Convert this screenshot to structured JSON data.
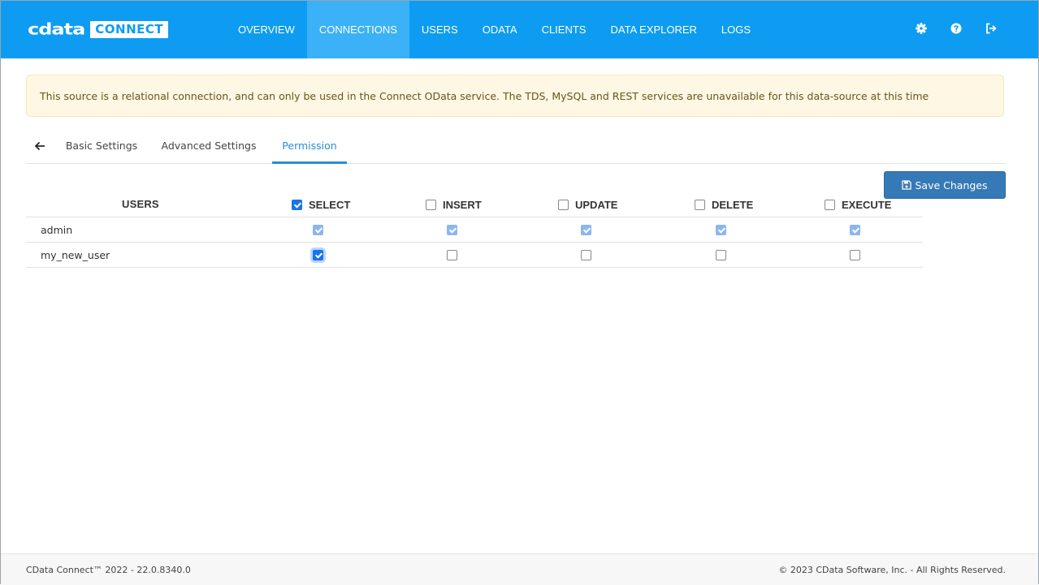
{
  "brand": {
    "word": "cdata",
    "badge": "CONNECT"
  },
  "nav": {
    "items": [
      {
        "label": "OVERVIEW",
        "active": false
      },
      {
        "label": "CONNECTIONS",
        "active": true
      },
      {
        "label": "USERS",
        "active": false
      },
      {
        "label": "ODATA",
        "active": false
      },
      {
        "label": "CLIENTS",
        "active": false
      },
      {
        "label": "DATA EXPLORER",
        "active": false
      },
      {
        "label": "LOGS",
        "active": false
      }
    ],
    "icons": [
      "gear-icon",
      "help-icon",
      "logout-icon"
    ]
  },
  "alert": {
    "text": "This source is a relational connection, and can only be used in the Connect OData service. The TDS, MySQL and REST services are unavailable for this data-source at this time"
  },
  "tabs": {
    "items": [
      {
        "label": "Basic Settings",
        "active": false
      },
      {
        "label": "Advanced Settings",
        "active": false
      },
      {
        "label": "Permission",
        "active": true
      }
    ]
  },
  "save_button": {
    "label": "Save Changes"
  },
  "permissions": {
    "users_header": "USERS",
    "columns": [
      {
        "label": "SELECT",
        "checked": true
      },
      {
        "label": "INSERT",
        "checked": false
      },
      {
        "label": "UPDATE",
        "checked": false
      },
      {
        "label": "DELETE",
        "checked": false
      },
      {
        "label": "EXECUTE",
        "checked": false
      }
    ],
    "rows": [
      {
        "user": "admin",
        "values": [
          true,
          true,
          true,
          true,
          true
        ],
        "disabled": true
      },
      {
        "user": "my_new_user",
        "values": [
          true,
          false,
          false,
          false,
          false
        ],
        "disabled": false
      }
    ]
  },
  "footer": {
    "left": "CData Connect™ 2022 - 22.0.8340.0",
    "right": "© 2023 CData Software, Inc. - All Rights Reserved."
  },
  "colors": {
    "topbar": "#0d9cf2",
    "active_nav": "#3bb1f7",
    "button": "#3679b7",
    "alert_bg": "#fdf7e4"
  }
}
